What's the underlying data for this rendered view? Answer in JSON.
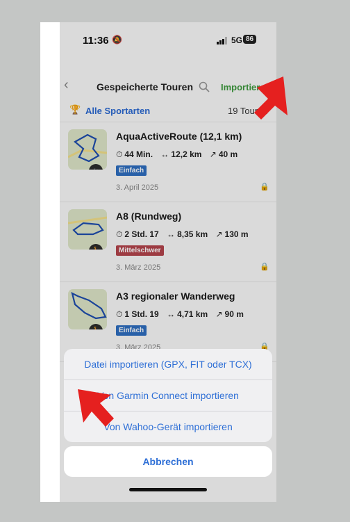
{
  "status_bar": {
    "time": "11:36",
    "network": "5G",
    "battery": "86"
  },
  "nav": {
    "title": "Gespeicherte Touren",
    "import_label": "Importieren"
  },
  "filter": {
    "label": "Alle Sportarten",
    "count": "19 Touren"
  },
  "tours": [
    {
      "title": "AquaActiveRoute (12,1 km)",
      "duration": "44 Min.",
      "distance": "12,2 km",
      "elevation": "40 m",
      "difficulty": "Einfach",
      "date": "3. April 2025"
    },
    {
      "title": "A8 (Rundweg)",
      "duration": "2 Std. 17",
      "distance": "8,35 km",
      "elevation": "130 m",
      "difficulty": "Mittelschwer",
      "date": "3. März 2025"
    },
    {
      "title": "A3 regionaler Wanderweg",
      "duration": "1 Std. 19",
      "distance": "4,71 km",
      "elevation": "90 m",
      "difficulty": "Einfach",
      "date": "3. März 2025"
    }
  ],
  "action_sheet": {
    "options": [
      "Datei importieren (GPX, FIT oder TCX)",
      "Von Garmin Connect importieren",
      "Von Wahoo-Gerät importieren"
    ],
    "cancel": "Abbrechen"
  },
  "colors": {
    "accent": "#2e6fd6",
    "import_green": "#3d9a3d",
    "easy_badge": "#2f6fc2",
    "medium_badge": "#b5444c",
    "annotation_arrow": "#e5201f"
  },
  "icons": {
    "back": "chevron-left-icon",
    "search": "search-icon",
    "mute": "bell-slash-icon",
    "filter": "trophy-icon",
    "lock": "lock-icon",
    "bike": "bike-icon",
    "hiker": "hiker-icon"
  }
}
